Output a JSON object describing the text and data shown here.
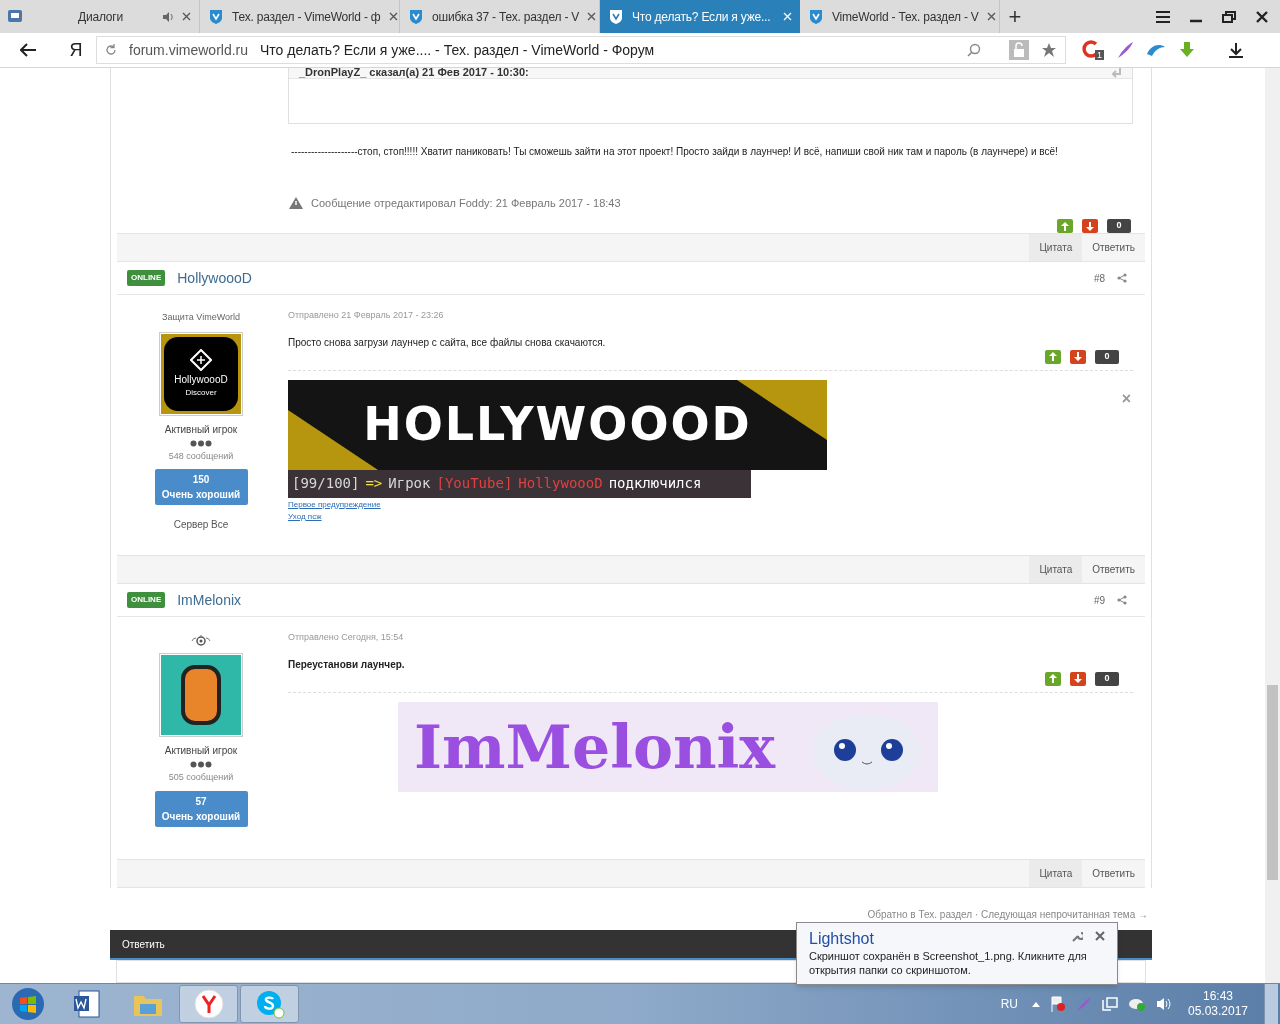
{
  "browser": {
    "tabs": [
      {
        "kind": "dialog",
        "title": "Диалоги",
        "selected": false,
        "sound": true
      },
      {
        "kind": "site",
        "title": "Тех. раздел - VimeWorld - ф",
        "selected": false,
        "sound": false
      },
      {
        "kind": "site",
        "title": "ошибка 37 - Тех. раздел - V",
        "selected": false,
        "sound": false
      },
      {
        "kind": "site",
        "title": "Что делать? Если я уже...",
        "selected": true,
        "sound": false
      },
      {
        "kind": "site",
        "title": "VimeWorld - Тех. раздел - V",
        "selected": false,
        "sound": false
      }
    ],
    "new_tab": "+",
    "yandex_button": "Я",
    "domain": "forum.vimeworld.ru",
    "page_title": "Что делать? Если я уже.... - Тех. раздел - VimeWorld - Форум",
    "extension_badge": "1"
  },
  "posts": [
    {
      "kind": "partial",
      "quote_author": "_DronPlayZ_ сказал(а) 21 Фев 2017 - 10:30:",
      "body": "--------------------стоп, стоп!!!!! Хватит паниковать! Ты сможешь зайти на этот проект! Просто зайди в лаунчер! И всё, напиши свой ник там и пароль (в лаунчере) и всё!",
      "edit_note": "Сообщение отредактировал Foddy: 21 Февраль 2017 - 18:43",
      "score": "0",
      "actions": [
        "Цитата",
        "Ответить"
      ]
    },
    {
      "kind": "full",
      "online": "ONLINE",
      "author": "HollywoooD",
      "number": "#8",
      "group": "Защита VimeWorld",
      "avatar": {
        "kind": "logo",
        "name": "HollywoooD",
        "sub": "Discover"
      },
      "rank": "Активный игрок",
      "post_count": "548 сообщений",
      "reputation": "150",
      "reputation_label": "Очень хороший",
      "server": "Сервер Все",
      "posted": "Отправлено 21 Февраль 2017 - 23:26",
      "body": "Просто снова загрузи лаунчер с сайта, все файлы снова скачаются.",
      "bold": false,
      "score": "0",
      "signature": {
        "kind": "hollywood",
        "title": "HOLLYWOOOD",
        "chat": [
          {
            "text": "[99/100]",
            "color": "#d8d8d8"
          },
          {
            "text": "=>",
            "color": "#f0e040"
          },
          {
            "text": "Игрок",
            "color": "#d8d8d8"
          },
          {
            "text": "[You",
            "color": "#e04040"
          },
          {
            "text": "Tube]",
            "color": "#e04040"
          },
          {
            "text": "HollywoooD",
            "color": "#e04040"
          },
          {
            "text": "подключился",
            "color": "#ffffff"
          }
        ],
        "links": [
          "Первое предупреждение",
          "Уход псж"
        ],
        "close": "×"
      },
      "actions": [
        "Цитата",
        "Ответить"
      ]
    },
    {
      "kind": "full",
      "online": "ONLINE",
      "author": "ImMelonix",
      "number": "#9",
      "avatar": {
        "kind": "photo"
      },
      "rank": "Активный игрок",
      "post_count": "505 сообщений",
      "reputation": "57",
      "reputation_label": "Очень хороший",
      "posted": "Отправлено Сегодня, 15:54",
      "body": "Переустанови лаунчер.",
      "bold": true,
      "score": "0",
      "signature": {
        "kind": "melonix",
        "title": "ImMelonix"
      },
      "actions": [
        "Цитата",
        "Ответить"
      ]
    }
  ],
  "topic_nav": "Обратно в Тех. раздел · Следующая непрочитанная тема →",
  "reply_bar": "Ответить",
  "notification": {
    "title": "Lightshot",
    "text": "Скриншот сохранён в Screenshot_1.png. Кликните для открытия папки со скриншотом."
  },
  "taskbar": {
    "apps": [
      {
        "kind": "word",
        "active": false
      },
      {
        "kind": "explorer",
        "active": false
      },
      {
        "kind": "yandex",
        "active": true
      },
      {
        "kind": "skype",
        "active": true
      }
    ],
    "language": "RU",
    "time": "16:43",
    "date": "05.03.2017"
  }
}
